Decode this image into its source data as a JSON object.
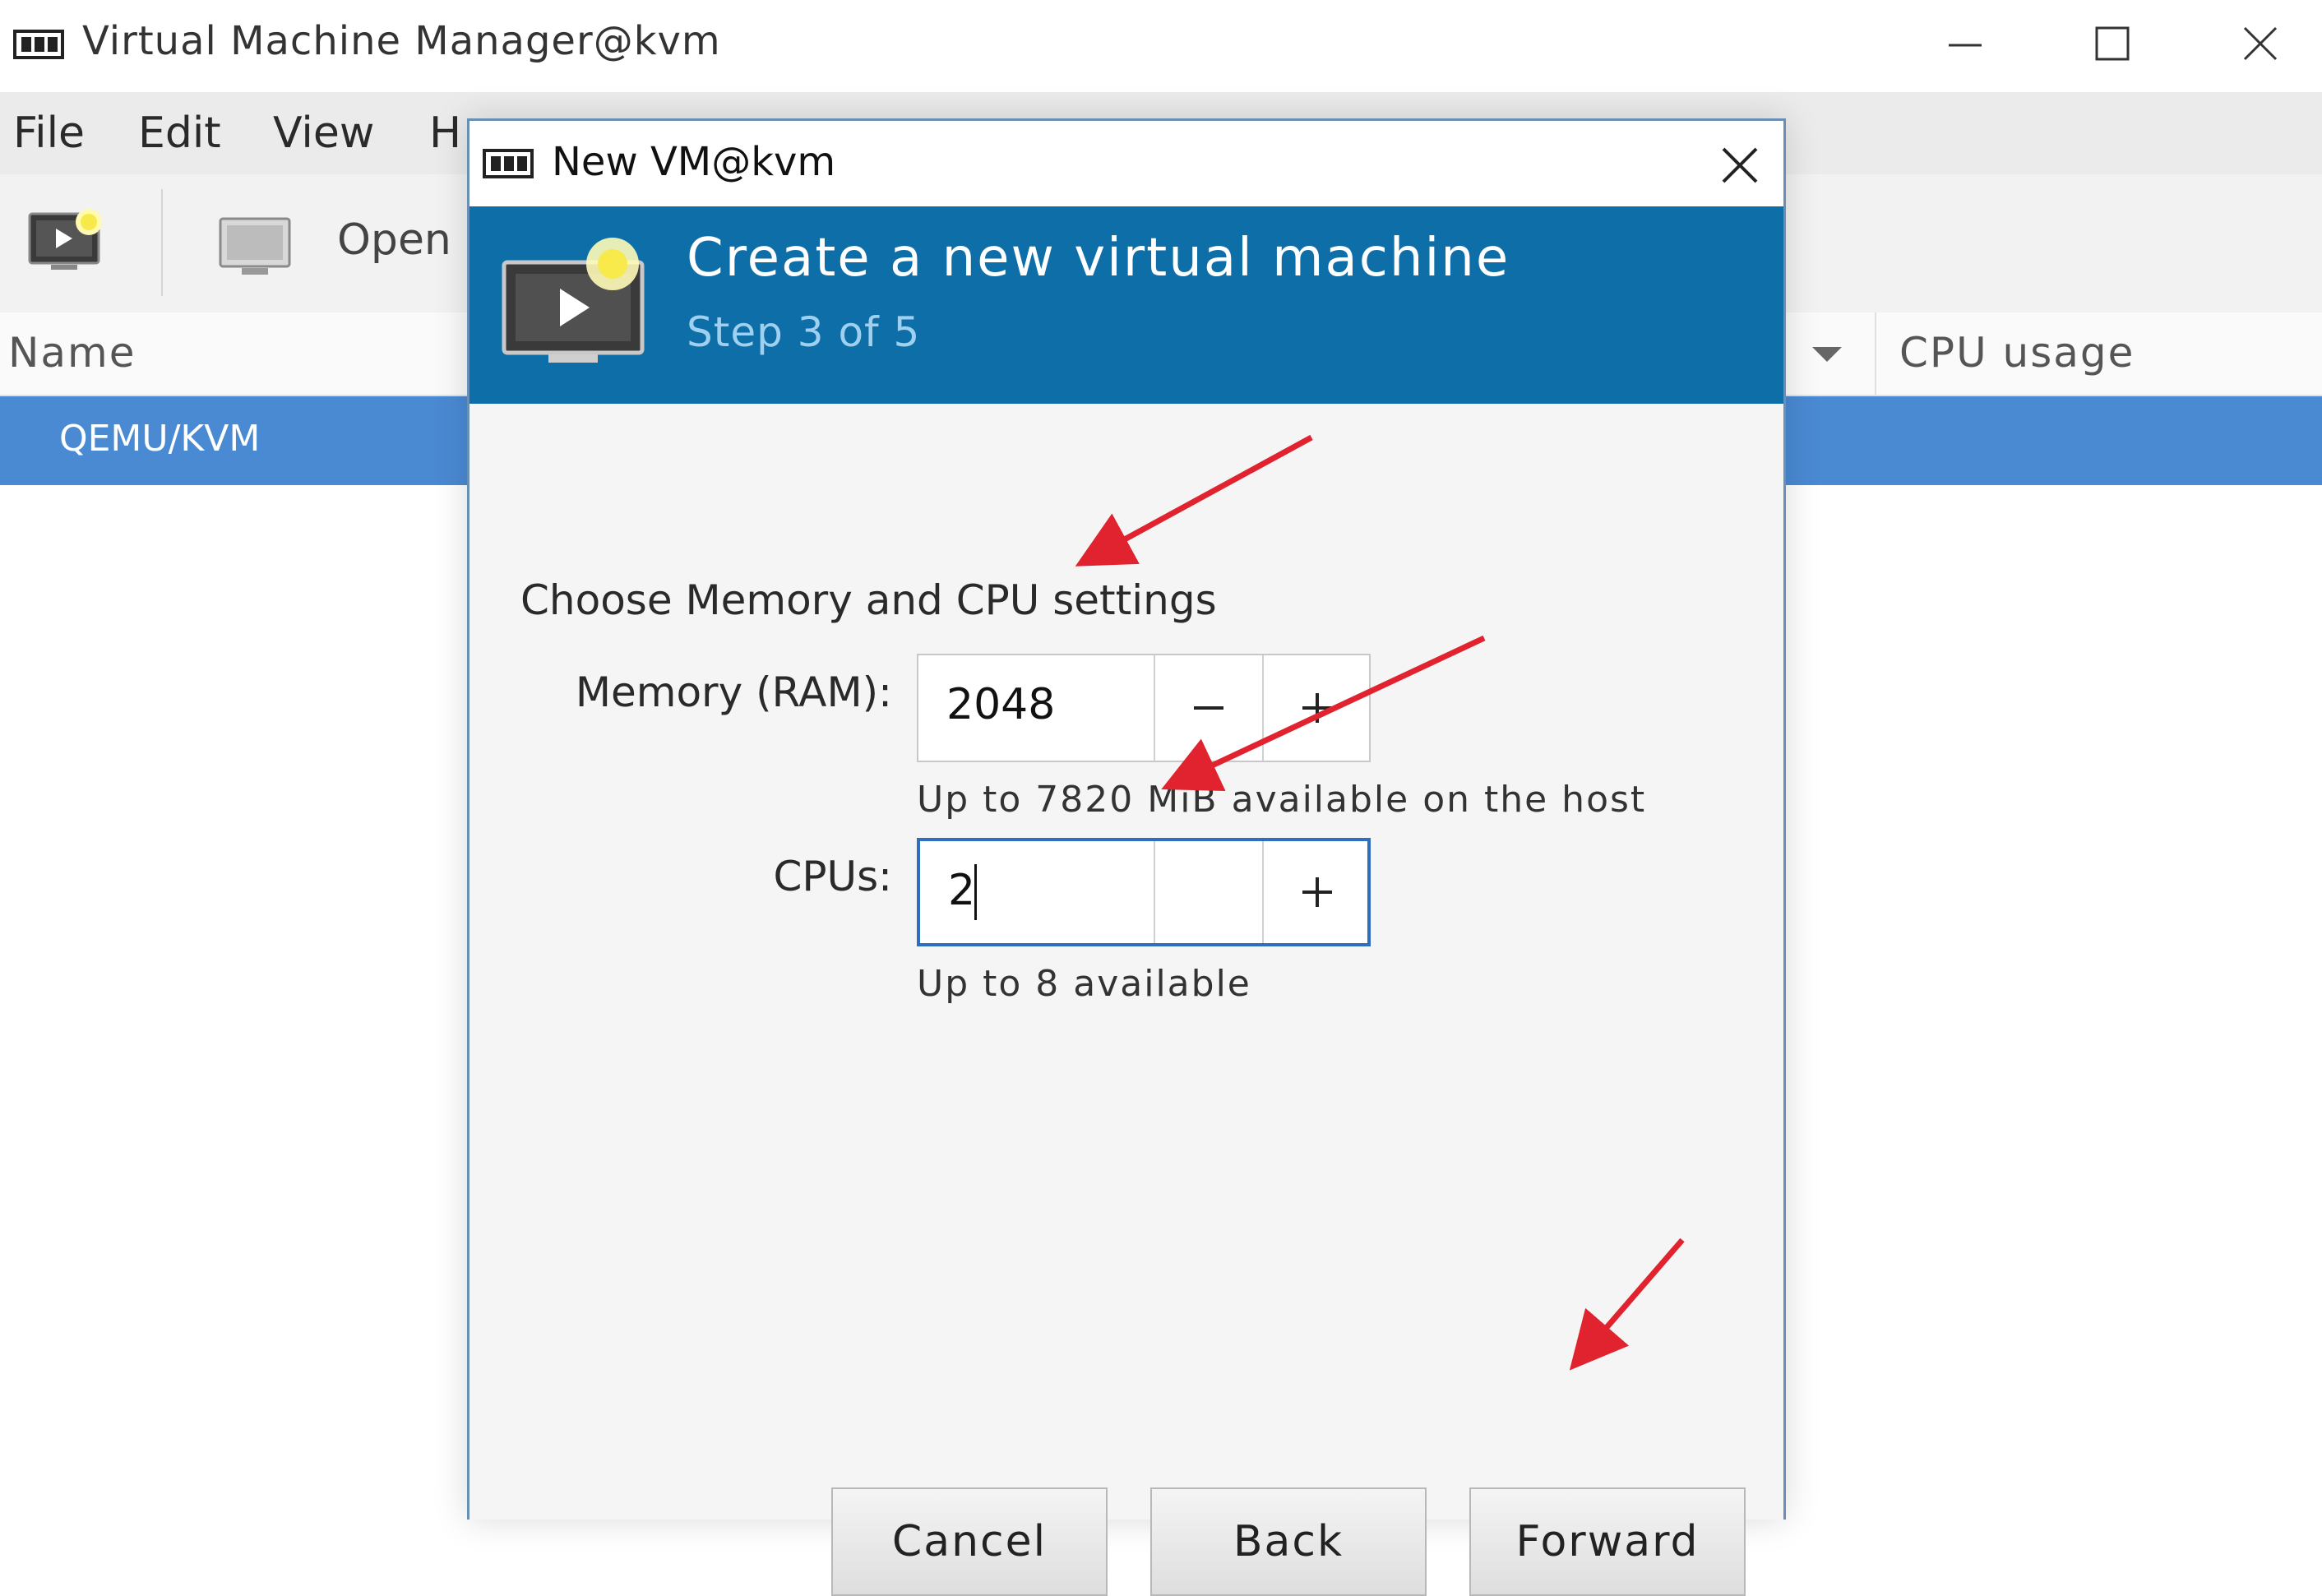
{
  "main_window": {
    "title": "Virtual Machine Manager@kvm",
    "menu": [
      "File",
      "Edit",
      "View",
      "H"
    ],
    "toolbar": {
      "open_label": "Open"
    },
    "columns": {
      "name": "Name",
      "cpu_usage": "CPU usage"
    },
    "rows": [
      {
        "name": "QEMU/KVM",
        "selected": true
      }
    ]
  },
  "dialog": {
    "title": "New VM@kvm",
    "banner": {
      "title": "Create a new virtual machine",
      "step": "Step 3 of 5"
    },
    "heading": "Choose Memory and CPU settings",
    "memory": {
      "label": "Memory (RAM):",
      "value": "2048",
      "hint": "Up to 7820 MiB available on the host"
    },
    "cpus": {
      "label": "CPUs:",
      "value": "2",
      "hint": "Up to 8 available"
    },
    "buttons": {
      "cancel": "Cancel",
      "back": "Back",
      "forward": "Forward"
    }
  },
  "colors": {
    "banner": "#0d6ea8",
    "selection": "#4a8ad3",
    "annotation_arrow": "#e0232e"
  }
}
